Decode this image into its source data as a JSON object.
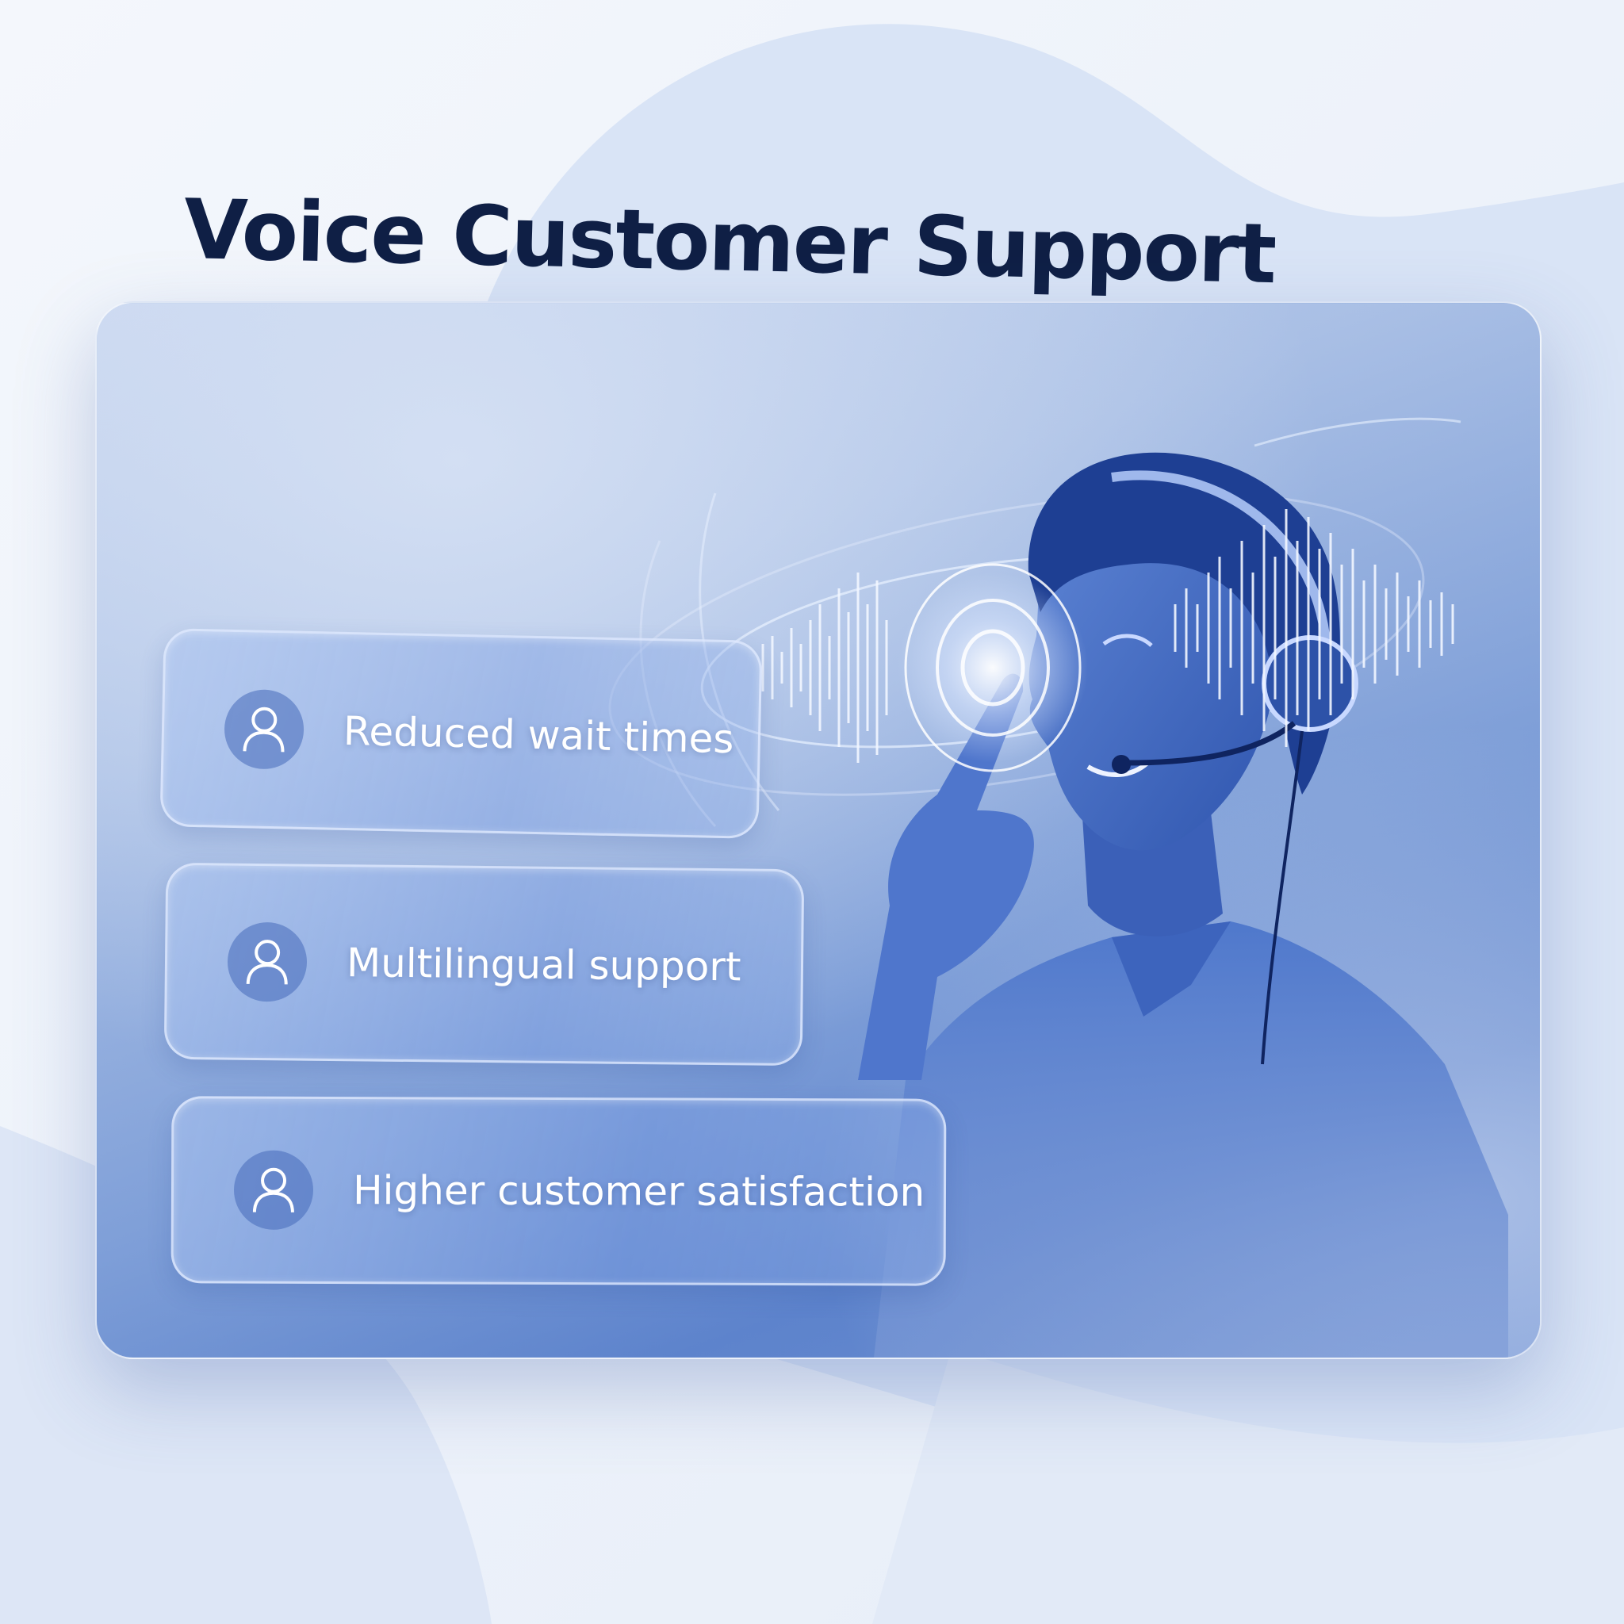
{
  "title": "Voice Customer Support",
  "features": [
    {
      "label": "Reduced wait times",
      "icon": "user-icon"
    },
    {
      "label": "Multilingual support",
      "icon": "user-icon"
    },
    {
      "label": "Higher customer satisfaction",
      "icon": "user-icon"
    }
  ],
  "illustration": "customer-support-agent-with-headset",
  "colors": {
    "background": "#eaf0fa",
    "title": "#0f1f45",
    "accent": "#3f63b8",
    "label": "#ffffff"
  }
}
